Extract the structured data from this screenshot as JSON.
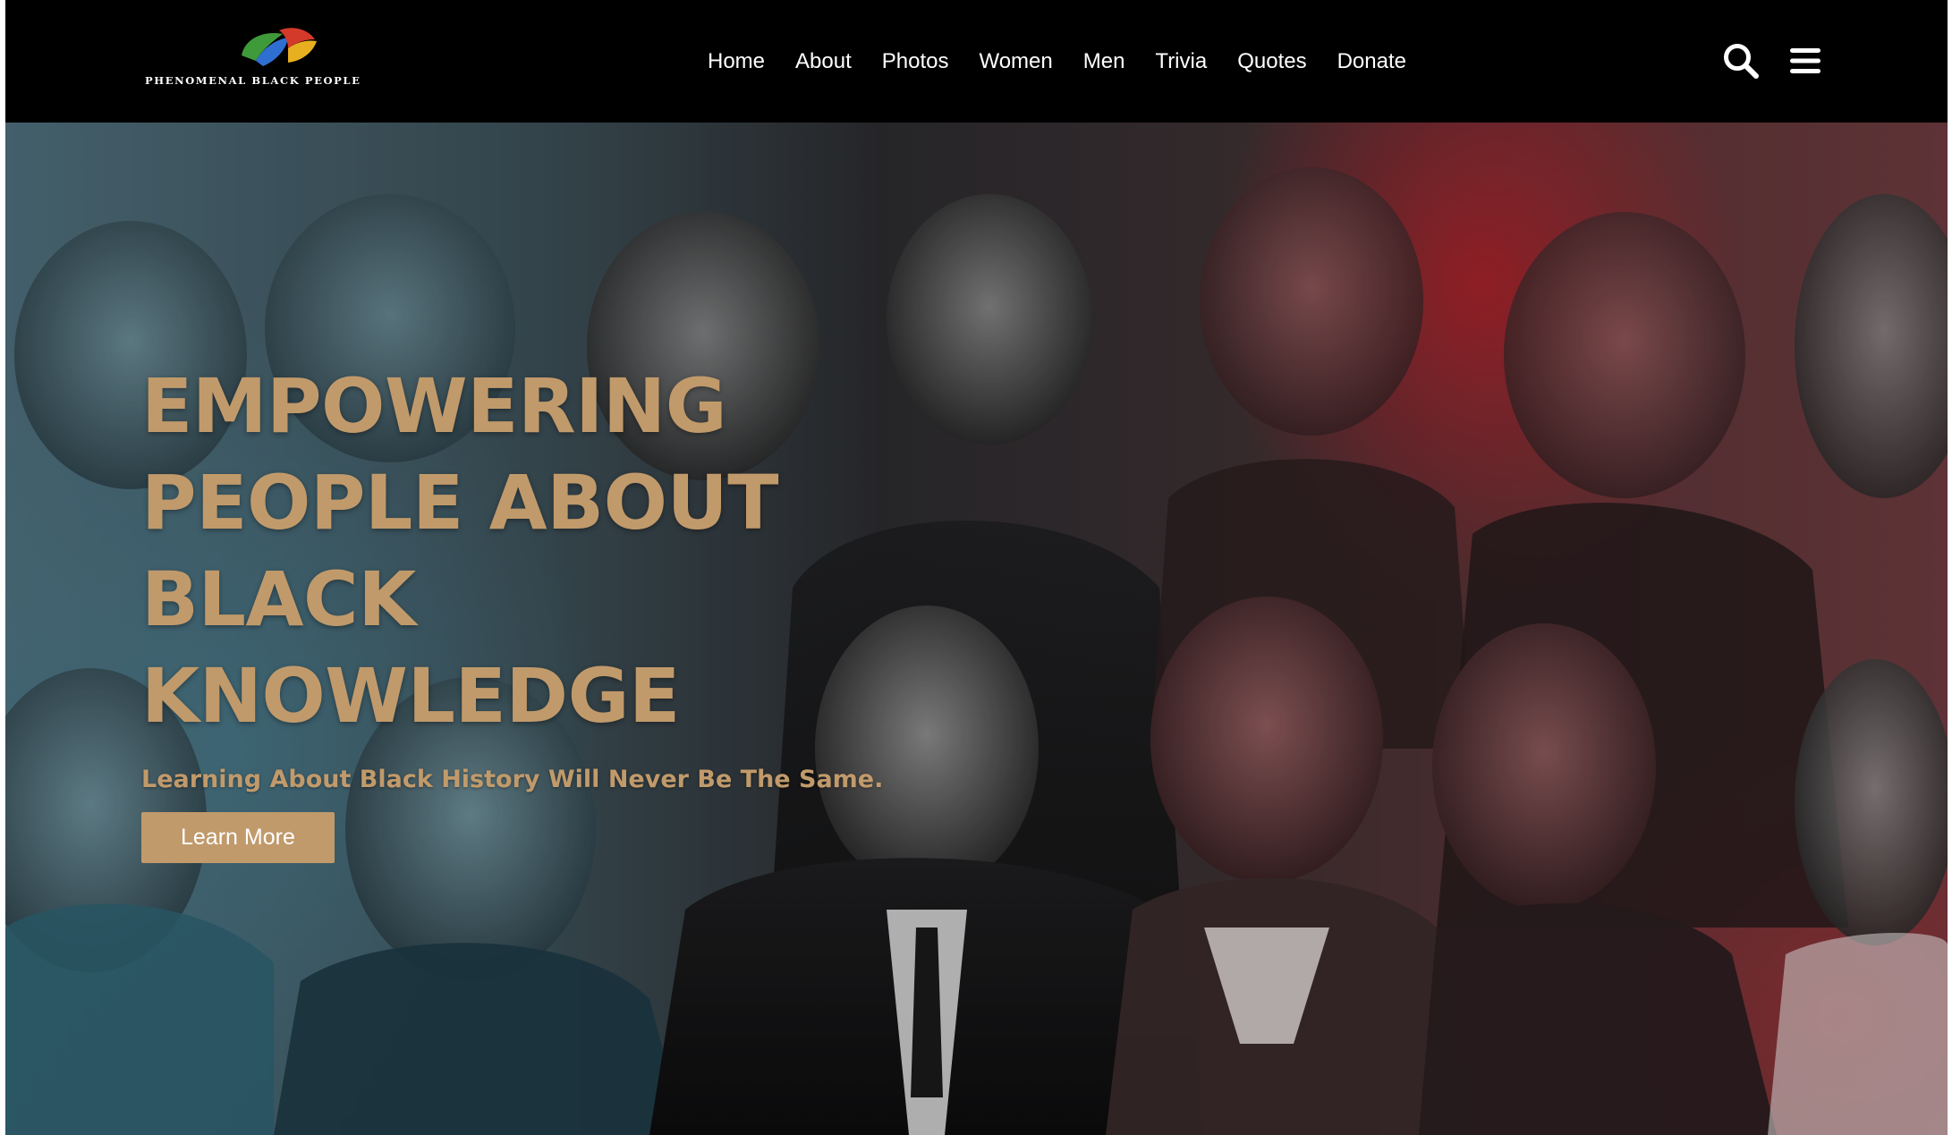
{
  "brand": {
    "logo_text": "PHENOMENAL BLACK PEOPLE",
    "logo_colors": [
      "#3f9a3a",
      "#2f6fd1",
      "#e8b020",
      "#d33a2a"
    ]
  },
  "nav": {
    "items": [
      {
        "label": "Home"
      },
      {
        "label": "About"
      },
      {
        "label": "Photos"
      },
      {
        "label": "Women"
      },
      {
        "label": "Men"
      },
      {
        "label": "Trivia"
      },
      {
        "label": "Quotes"
      },
      {
        "label": "Donate"
      }
    ]
  },
  "header_icons": {
    "search": "search-icon",
    "menu": "hamburger-menu-icon"
  },
  "hero": {
    "title_lines": [
      "EMPOWERING",
      "PEOPLE ABOUT",
      "BLACK KNOWLEDGE"
    ],
    "subtitle": "Learning About Black History Will Never Be The Same.",
    "button_label": "Learn More",
    "accent_color": "#c19a6b",
    "background_image": "collage-of-portraits"
  }
}
